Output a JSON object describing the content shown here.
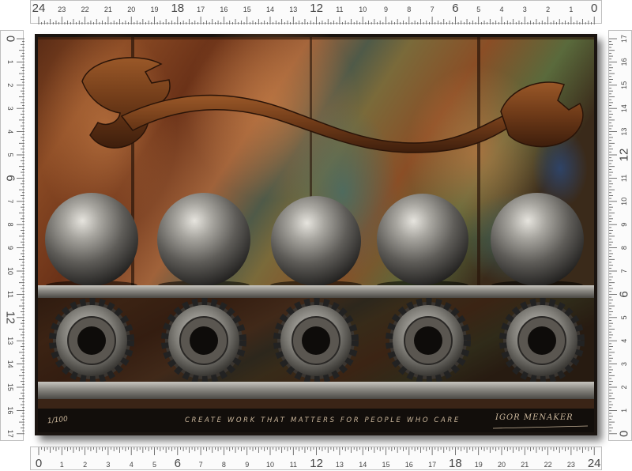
{
  "rulers": {
    "top_labels": [
      "24",
      "23",
      "22",
      "21",
      "20",
      "19",
      "18",
      "17",
      "16",
      "15",
      "14",
      "13",
      "12",
      "11",
      "10",
      "9",
      "8",
      "7",
      "6",
      "5",
      "4",
      "3",
      "2",
      "1",
      "0"
    ],
    "bottom_labels": [
      "0",
      "1",
      "2",
      "3",
      "4",
      "5",
      "6",
      "7",
      "8",
      "9",
      "10",
      "11",
      "12",
      "13",
      "14",
      "15",
      "16",
      "17",
      "18",
      "19",
      "20",
      "21",
      "22",
      "23",
      "24"
    ],
    "left_labels": [
      "0",
      "1",
      "2",
      "3",
      "4",
      "5",
      "6",
      "7",
      "8",
      "9",
      "10",
      "11",
      "12",
      "13",
      "14",
      "15",
      "16",
      "17"
    ],
    "right_labels": [
      "17",
      "16",
      "15",
      "14",
      "13",
      "12",
      "11",
      "10",
      "9",
      "8",
      "7",
      "6",
      "5",
      "4",
      "3",
      "2",
      "1",
      "0"
    ],
    "major_labels": [
      "0",
      "6",
      "12",
      "18",
      "24"
    ],
    "tick_color": "#555555"
  },
  "artwork": {
    "subject": [
      "wrench-icon",
      "steel-ball-icon",
      "gear-icon",
      "metal-shelf-icon"
    ],
    "ball_count": 5,
    "gear_count": 5,
    "colors": {
      "rust": "#7a3f1c",
      "copper": "#a8602e",
      "steel": "#9a9a98",
      "teal": "#3f6f6c",
      "dark": "#1a1410",
      "caption": "#c9b59a"
    }
  },
  "captions": {
    "edition": "1/100",
    "slogan": "CREATE WORK THAT MATTERS FOR PEOPLE WHO CARE",
    "signature": "IGOR MENAKER"
  }
}
